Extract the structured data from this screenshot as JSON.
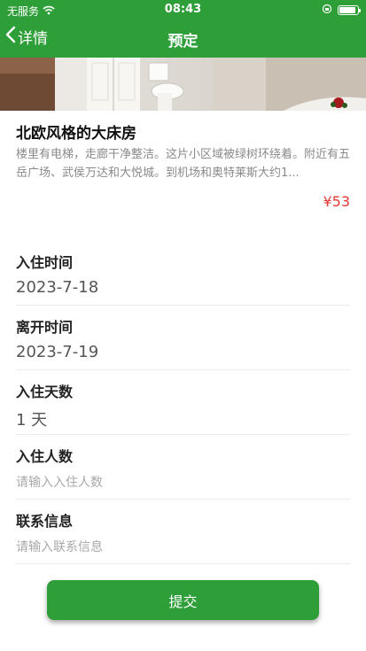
{
  "status_bar": {
    "carrier": "无服务",
    "time": "08:43",
    "battery_level": 0.9
  },
  "nav": {
    "back_label": "详情",
    "title": "预定"
  },
  "room": {
    "title": "北欧风格的大床房",
    "description": "楼里有电梯，走廊干净整洁。这片小区域被绿树环绕着。附近有五岳广场、武侯万达和大悦城。到机场和奥特莱斯大约1...",
    "price": "¥53"
  },
  "form": {
    "checkin": {
      "label": "入住时间",
      "value": "2023-7-18"
    },
    "checkout": {
      "label": "离开时间",
      "value": "2023-7-19"
    },
    "nights": {
      "label": "入住天数",
      "value": "1 天"
    },
    "guests": {
      "label": "入住人数",
      "placeholder": "请输入入住人数"
    },
    "contact": {
      "label": "联系信息",
      "placeholder": "请输入联系信息"
    }
  },
  "submit_label": "提交",
  "colors": {
    "accent": "#2e9e39",
    "price": "#e53935"
  }
}
